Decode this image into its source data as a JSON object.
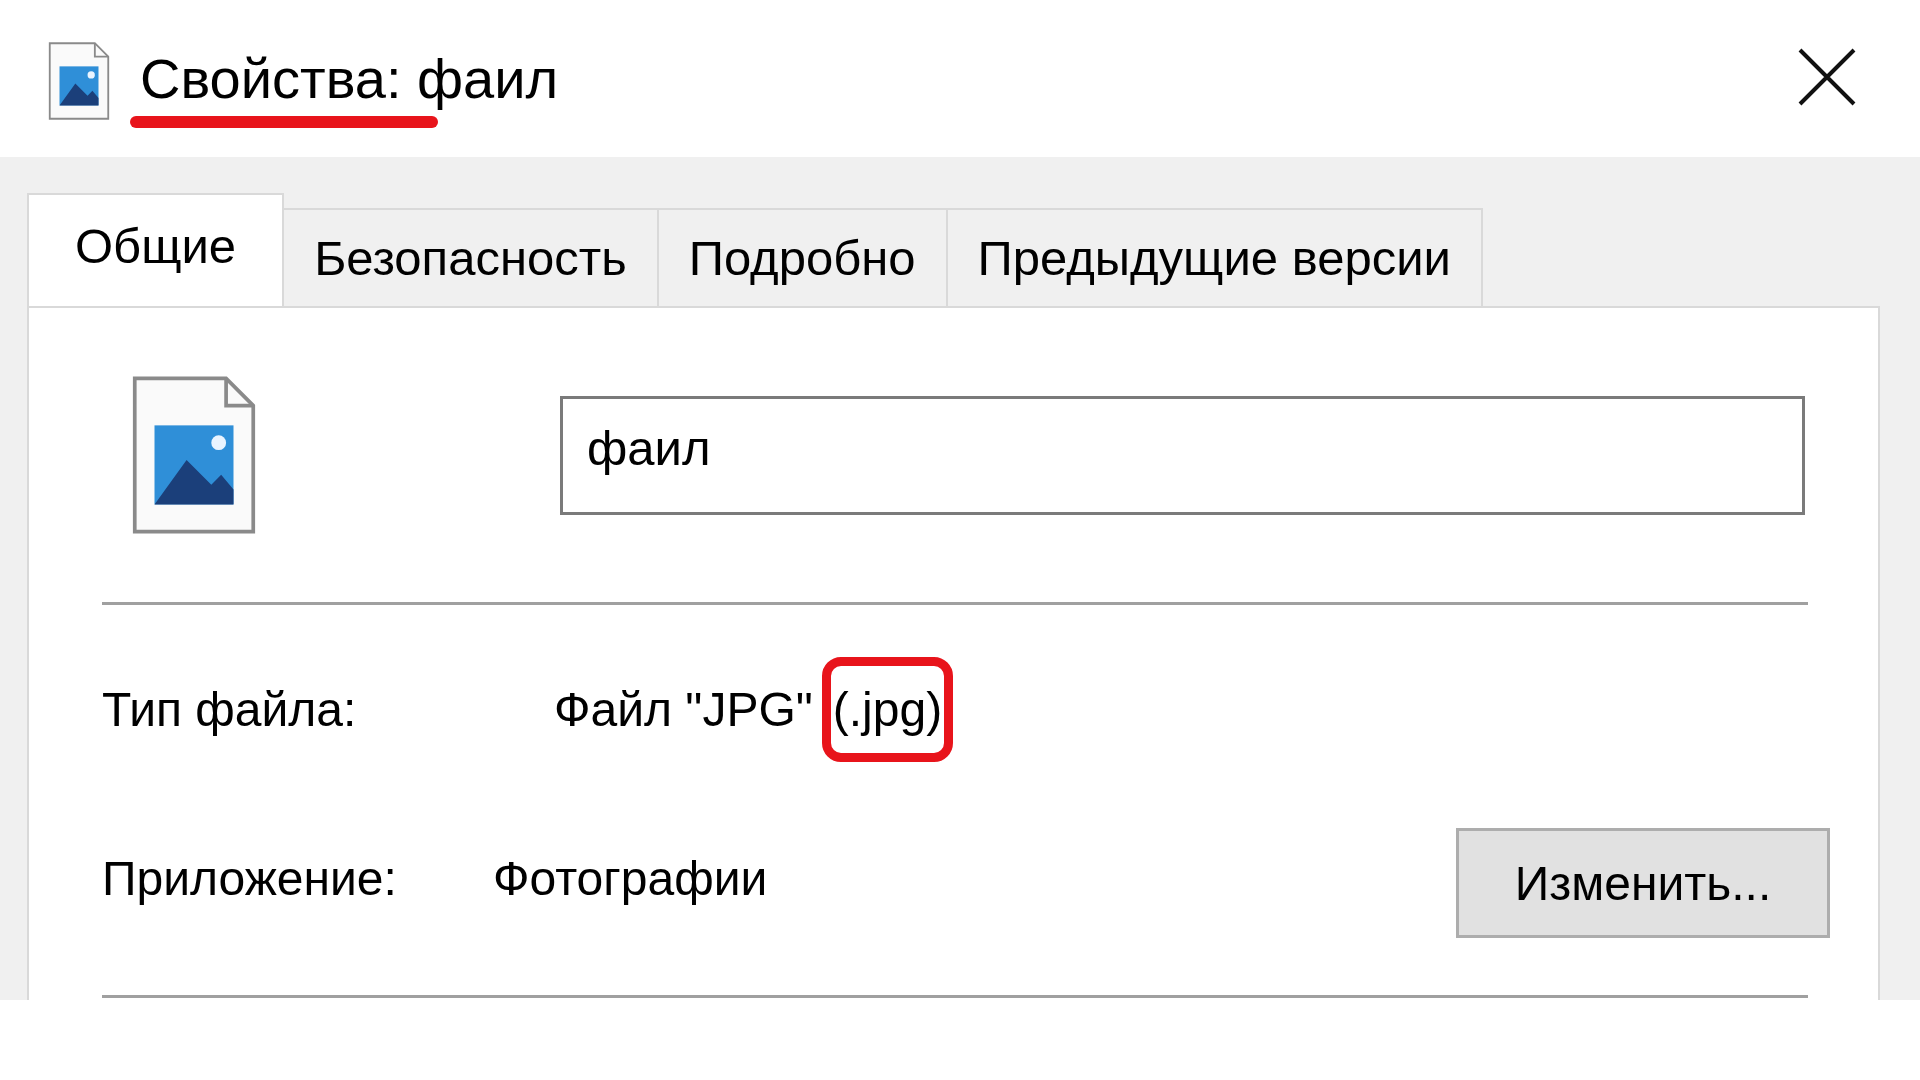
{
  "window": {
    "title": "Свойства: фаил",
    "title_underlined": true
  },
  "tabs": [
    {
      "label": "Общие",
      "selected": true
    },
    {
      "label": "Безопасность",
      "selected": false
    },
    {
      "label": "Подробно",
      "selected": false
    },
    {
      "label": "Предыдущие версии",
      "selected": false
    }
  ],
  "name_field": {
    "value": "фаил"
  },
  "file_type": {
    "label": "Тип файла:",
    "value": "Файл \"JPG\"",
    "extension": "(.jpg)",
    "extension_highlighted": true
  },
  "application": {
    "label": "Приложение:",
    "value": "Фотографии",
    "button": "Изменить..."
  }
}
